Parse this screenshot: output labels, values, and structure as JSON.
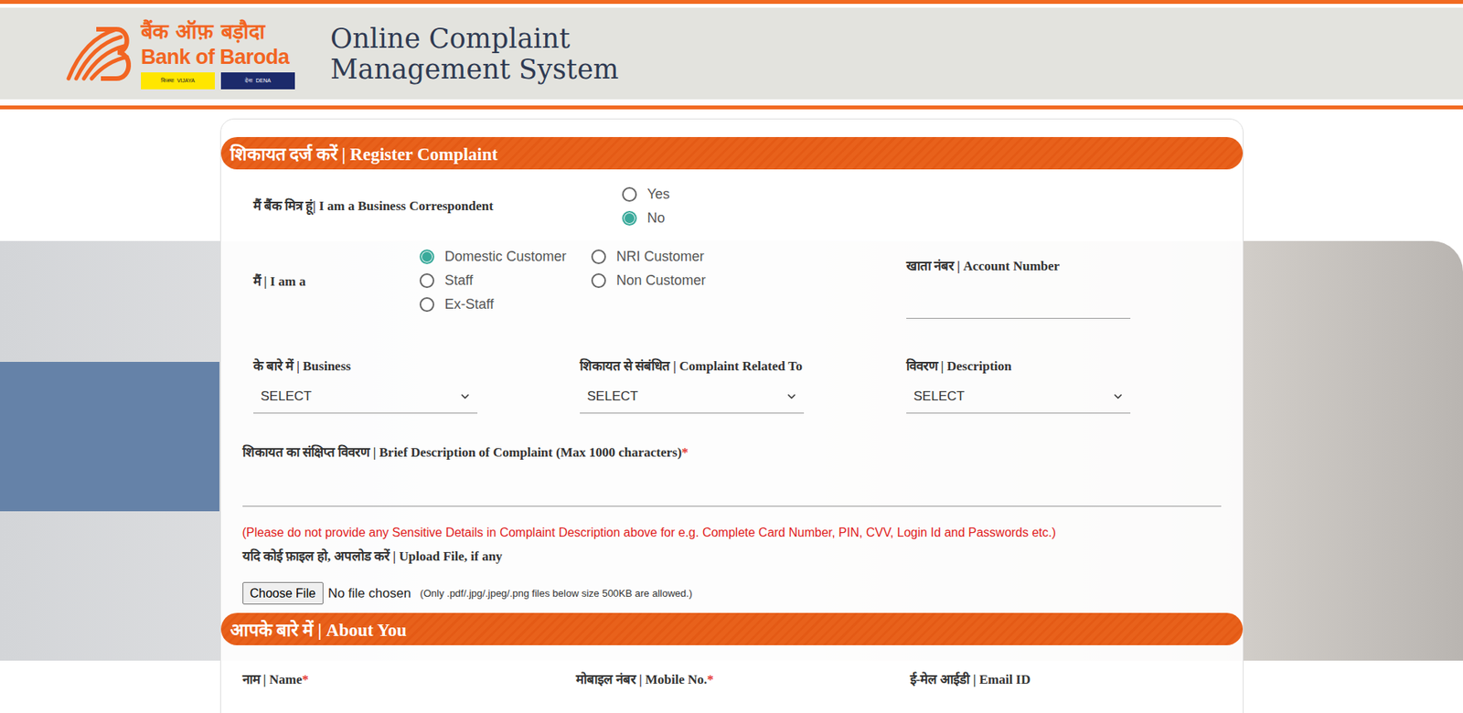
{
  "header": {
    "logo": {
      "hindi": "बैंक ऑफ़ बड़ौदा",
      "english": "Bank of Baroda",
      "badges": [
        {
          "hindi": "विजया",
          "english": "VIJAYA",
          "color": "#ffe600"
        },
        {
          "hindi": "देना",
          "english": "DENA",
          "color": "#1c2a6b"
        }
      ]
    },
    "title": [
      "Online Complaint",
      "Management System"
    ]
  },
  "register": {
    "title": "शिकायत दर्ज करें | Register Complaint"
  },
  "business_correspondent": {
    "label": "मैं बैंक मित्र हूं| I am a Business Correspondent",
    "options": [
      {
        "label": "Yes",
        "selected": false
      },
      {
        "label": "No",
        "selected": true
      }
    ]
  },
  "customer_type": {
    "label": "मैं | I am a",
    "options": [
      {
        "label": "Domestic Customer",
        "selected": true
      },
      {
        "label": "NRI Customer",
        "selected": false
      },
      {
        "label": "Staff",
        "selected": false
      },
      {
        "label": "Non Customer",
        "selected": false
      },
      {
        "label": "Ex-Staff",
        "selected": false
      }
    ]
  },
  "account": {
    "label": "खाता नंबर | Account Number",
    "value": ""
  },
  "selects": [
    {
      "label": "के बारे में | Business",
      "value": "SELECT"
    },
    {
      "label": "शिकायत से संबंधित | Complaint Related To",
      "value": "SELECT"
    },
    {
      "label": "विवरण | Description",
      "value": "SELECT"
    }
  ],
  "required_mark": "*",
  "description": {
    "label": "शिकायत का संक्षिप्त विवरण | Brief Description of Complaint (Max 1000 characters)",
    "required": true,
    "value": ""
  },
  "warning": "(Please do not provide any Sensitive Details in Complaint Description above for e.g. Complete Card Number, PIN, CVV, Login Id and Passwords etc.)",
  "upload": {
    "label": "यदि कोई फ़ाइल हो, अपलोड करें | Upload File, if any",
    "button": "Choose File",
    "status": "No file chosen",
    "hint": "(Only .pdf/.jpg/.jpeg/.png files below size 500KB are allowed.)"
  },
  "about": {
    "title": "आपके बारे में | About You",
    "fields": [
      {
        "label": "नाम | Name",
        "required": true
      },
      {
        "label": "मोबाइल नंबर | Mobile No.",
        "required": true
      },
      {
        "label": "ई-मेल आईडी | Email ID",
        "required": false
      }
    ]
  }
}
